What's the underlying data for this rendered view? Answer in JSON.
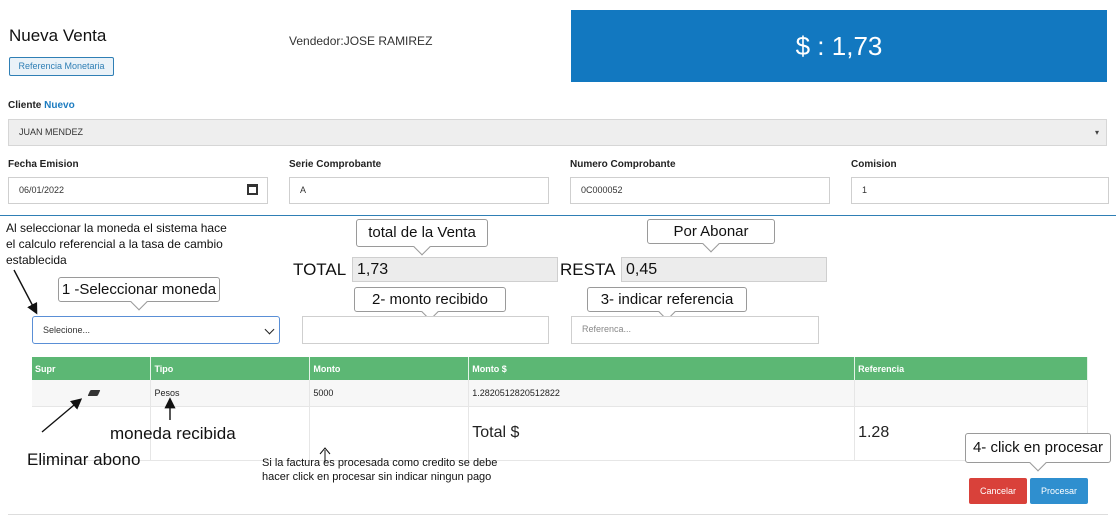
{
  "header": {
    "title": "Nueva Venta",
    "ref_button": "Referencia Monetaria",
    "seller_label": "Vendedor:",
    "seller_name": "JOSE RAMIREZ",
    "total_display": "$ : 1,73"
  },
  "colors": {
    "primary": "#1278c0",
    "table_header": "#5cb774",
    "cancel": "#d9413a",
    "process": "#2f8fcf"
  },
  "client": {
    "label": "Cliente",
    "new_link": "Nuevo",
    "value": "JUAN MENDEZ"
  },
  "form": {
    "fecha_label": "Fecha Emision",
    "fecha_value": "06/01/2022",
    "serie_label": "Serie Comprobante",
    "serie_value": "A",
    "numero_label": "Numero Comprobante",
    "numero_value": "0C000052",
    "comision_label": "Comision",
    "comision_value": "1"
  },
  "notes": {
    "currency_note": "Al seleccionar la moneda el sistema hace el calculo referencial a la tasa de cambio establecida",
    "credit_note": "Si la factura es procesada como credito se debe hacer click en procesar sin indicar ningun pago"
  },
  "callouts": {
    "total_venta": "total de la Venta",
    "por_abonar": "Por Abonar",
    "step1": "1 -Seleccionar moneda",
    "step2": "2- monto recibido",
    "step3": "3- indicar referencia",
    "step4": "4- click en procesar",
    "moneda_recibida": "moneda recibida",
    "eliminar_abono": "Eliminar abono"
  },
  "payment": {
    "total_label": "TOTAL",
    "total_value": "1,73",
    "resta_label": "RESTA",
    "resta_value": "0,45",
    "currency_select": "Selecione...",
    "amount_value": "",
    "reference_placeholder": "Referenca..."
  },
  "table": {
    "headers": [
      "Supr",
      "Tipo",
      "Monto",
      "Monto $",
      "Referencia"
    ],
    "rows": [
      {
        "tipo": "Pesos",
        "monto": "5000",
        "monto_usd": "1.2820512820512822",
        "referencia": ""
      }
    ],
    "total_label": "Total $",
    "total_value": "1.28"
  },
  "actions": {
    "cancel": "Cancelar",
    "process": "Procesar"
  }
}
